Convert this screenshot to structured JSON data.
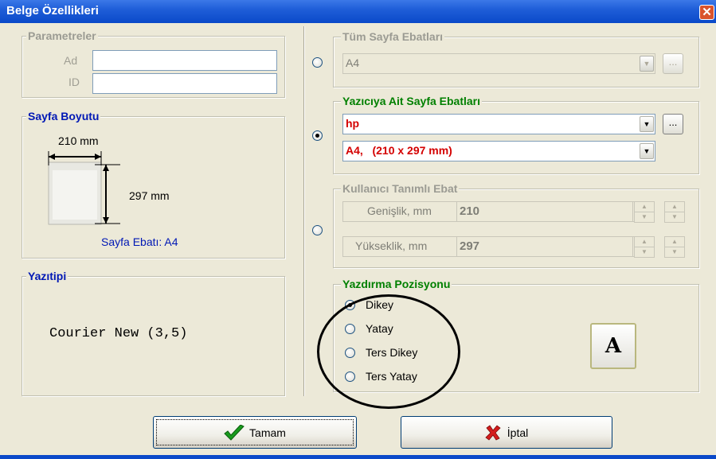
{
  "window": {
    "title": "Belge Özellikleri",
    "close_glyph": "✕"
  },
  "parametreler": {
    "legend": "Parametreler",
    "ad_label": "Ad",
    "ad_value": "",
    "id_label": "ID",
    "id_value": ""
  },
  "sayfa_boyutu": {
    "legend": "Sayfa Boyutu",
    "width_label": "210 mm",
    "height_label": "297 mm",
    "ebat_label": "Sayfa Ebatı: A4"
  },
  "yazitipi": {
    "legend": "Yazıtipi",
    "font_display": "Courier New (3,5)"
  },
  "tum_sayfa": {
    "legend": "Tüm Sayfa Ebatları",
    "selected": "A4",
    "ellipsis": "..."
  },
  "yazici": {
    "legend": "Yazıcıya Ait Sayfa Ebatları",
    "printer": "hp",
    "paper": "A4,   (210 x 297 mm)",
    "ellipsis": "..."
  },
  "kullanici": {
    "legend": "Kullanıcı Tanımlı Ebat",
    "genislik_label": "Genişlik, mm",
    "genislik_value": "210",
    "yukseklik_label": "Yükseklik, mm",
    "yukseklik_value": "297"
  },
  "yazdirma": {
    "legend": "Yazdırma Pozisyonu",
    "options": [
      "Dikey",
      "Yatay",
      "Ters Dikey",
      "Ters Yatay"
    ],
    "selected": "Dikey",
    "preview_letter": "A"
  },
  "buttons": {
    "ok": "Tamam",
    "cancel": "İptal",
    "ok_icon": "checkmark-icon",
    "cancel_icon": "x-icon"
  },
  "colors": {
    "title_bar": "#0a49c9",
    "accent_green": "#008000",
    "accent_blue": "#0018b5",
    "selected_red": "#d40000"
  }
}
